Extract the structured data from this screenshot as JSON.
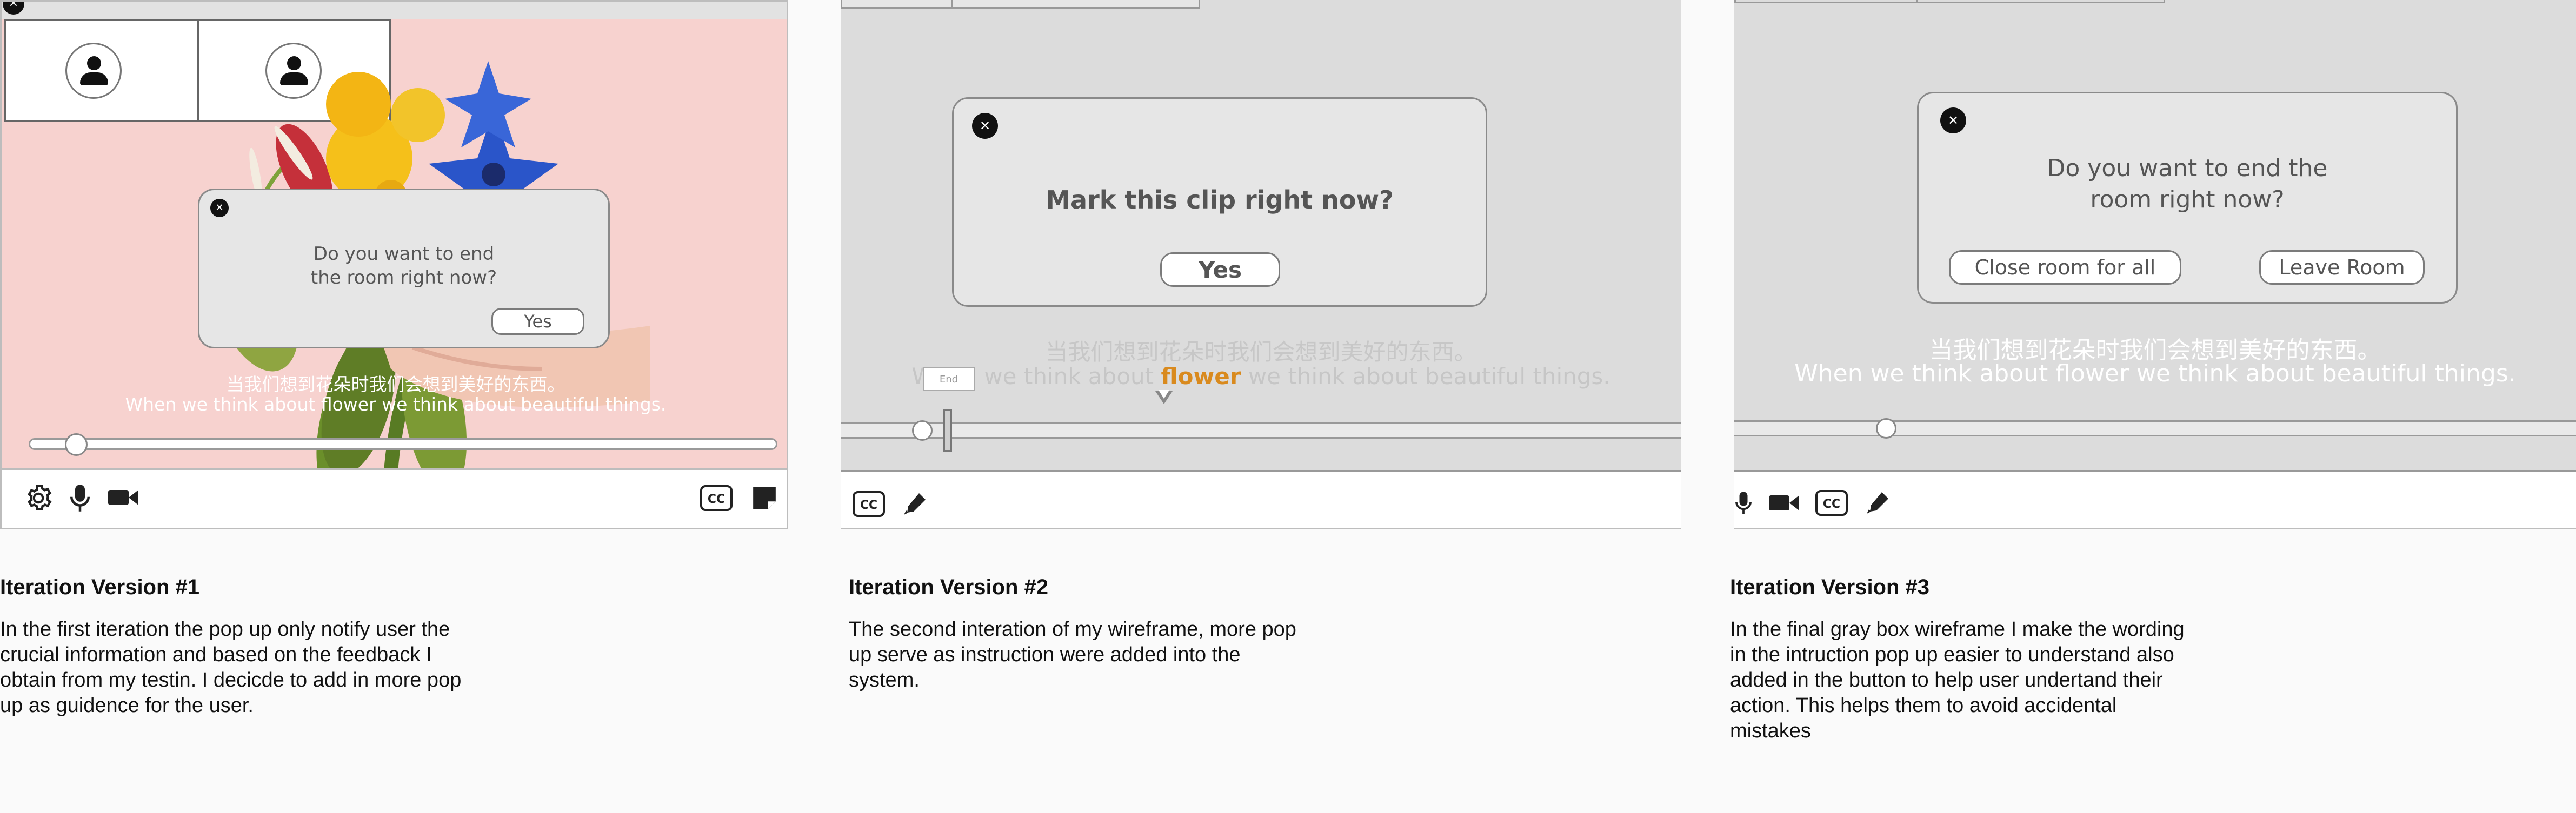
{
  "panel1": {
    "dialog_text_line1": "Do you want to end",
    "dialog_text_line2": "the room right now?",
    "yes_label": "Yes",
    "close_glyph": "✕",
    "subtitle_cn": "当我们想到花朵时我们会想到美好的东西。",
    "subtitle_en": "When we think about flower we think about beautiful things.",
    "toolbar_icons": [
      "gear-icon",
      "mic-icon",
      "video-camera-icon",
      "closed-caption-icon",
      "sticky-note-icon"
    ],
    "cc_label": "CC",
    "progress": 0.05,
    "caption_title": "Iteration Version #1",
    "caption_lines": [
      "In the first iteration the pop up only notify user the",
      "crucial information and based on the feedback I",
      "obtain from my testin. I decicde to add in more pop",
      "up as guidence for the user."
    ]
  },
  "panel2": {
    "dialog_text": "Mark this clip right now?",
    "yes_label": "Yes",
    "close_glyph": "✕",
    "subtitle_cn": "当我们想到花朵时我们会想到美好的东西。",
    "subtitle_en_before": "When we think about",
    "subtitle_en_highlight": "flower",
    "subtitle_en_after": "we think about beautiful things.",
    "end_tag": "End",
    "cc_label": "CC",
    "toolbar_icons": [
      "closed-caption-icon",
      "marker-pen-icon"
    ],
    "caption_title": "Iteration Version #2",
    "caption_lines": [
      "The second interation of my wireframe, more pop",
      "up serve as instruction were added into the",
      "system."
    ]
  },
  "panel3": {
    "dialog_text_line1": "Do you want to end the",
    "dialog_text_line2": "room right now?",
    "close_all_label": "Close room for all",
    "leave_label": "Leave Room",
    "close_glyph": "✕",
    "subtitle_cn": "当我们想到花朵时我们会想到美好的东西。",
    "subtitle_en": "When we think about flower we think about beautiful things.",
    "cc_label": "CC",
    "toolbar_icons": [
      "mic-icon",
      "video-camera-icon",
      "closed-caption-icon",
      "marker-pen-icon"
    ],
    "caption_title": "Iteration Version #3",
    "caption_lines": [
      "In the final gray box wireframe I make the wording",
      "in the intruction pop up easier to understand also",
      "added in the button to help user undertand their",
      "action. This helps them to avoid accidental",
      "mistakes"
    ]
  },
  "colors": {
    "pink_bg": "#f7d2cf",
    "gray_stage": "#dcdcdc",
    "dialog_bg": "#e6e6e6",
    "highlight_orange": "#d98a1e"
  }
}
